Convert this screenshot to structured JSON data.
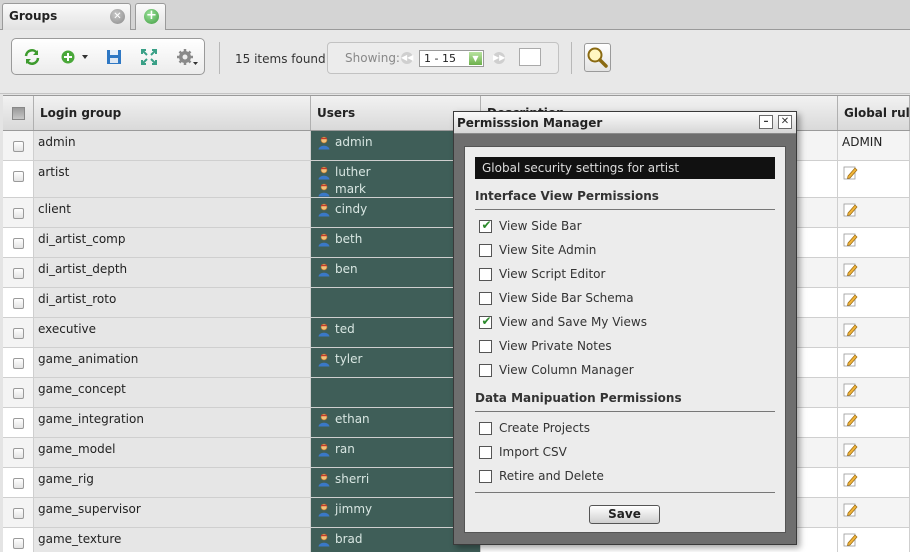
{
  "tabs": [
    {
      "label": "Groups",
      "close_glyph": "✕",
      "active": true
    }
  ],
  "add_tab_glyph": "+",
  "toolbar": {
    "icons": [
      "refresh-icon",
      "add-icon",
      "save-icon",
      "expand-icon",
      "settings-icon"
    ],
    "items_found": "15 items found",
    "showing_label": "Showing:",
    "page_range": "1 - 15",
    "prev_glyph": "◀◀",
    "next_glyph": "▶▶",
    "dropdown_glyph": "▼",
    "search_icon": "magnifier-icon"
  },
  "columns": {
    "login_group": "Login group",
    "users": "Users",
    "description": "Description",
    "global_rules": "Global rules"
  },
  "rows": [
    {
      "login": "admin",
      "users": [
        "admin"
      ],
      "global": "ADMIN"
    },
    {
      "login": "artist",
      "users": [
        "luther",
        "mark"
      ],
      "global": ""
    },
    {
      "login": "client",
      "users": [
        "cindy"
      ],
      "global": ""
    },
    {
      "login": "di_artist_comp",
      "users": [
        "beth"
      ],
      "global": ""
    },
    {
      "login": "di_artist_depth",
      "users": [
        "ben"
      ],
      "global": ""
    },
    {
      "login": "di_artist_roto",
      "users": [],
      "global": ""
    },
    {
      "login": "executive",
      "users": [
        "ted"
      ],
      "global": ""
    },
    {
      "login": "game_animation",
      "users": [
        "tyler"
      ],
      "global": ""
    },
    {
      "login": "game_concept",
      "users": [],
      "global": ""
    },
    {
      "login": "game_integration",
      "users": [
        "ethan"
      ],
      "global": ""
    },
    {
      "login": "game_model",
      "users": [
        "ran"
      ],
      "global": ""
    },
    {
      "login": "game_rig",
      "users": [
        "sherri"
      ],
      "global": ""
    },
    {
      "login": "game_supervisor",
      "users": [
        "jimmy"
      ],
      "global": ""
    },
    {
      "login": "game_texture",
      "users": [
        "brad"
      ],
      "global": ""
    }
  ],
  "dialog": {
    "title": "Permisssion Manager",
    "minimize_glyph": "–",
    "close_glyph": "✕",
    "heading": "Global security settings for artist",
    "interface_title": "Interface View Permissions",
    "interface_permissions": [
      {
        "label": "View Side Bar",
        "checked": true
      },
      {
        "label": "View Site Admin",
        "checked": false
      },
      {
        "label": "View Script Editor",
        "checked": false
      },
      {
        "label": "View Side Bar Schema",
        "checked": false
      },
      {
        "label": "View and Save My Views",
        "checked": true
      },
      {
        "label": "View Private Notes",
        "checked": false
      },
      {
        "label": "View Column Manager",
        "checked": false
      }
    ],
    "data_title": "Data Manipuation Permissions",
    "data_permissions": [
      {
        "label": "Create Projects",
        "checked": false
      },
      {
        "label": "Import CSV",
        "checked": false
      },
      {
        "label": "Retire and Delete",
        "checked": false
      }
    ],
    "save_label": "Save",
    "check_glyph": "✔"
  },
  "colors": {
    "users_column_bg": "#3f5e58",
    "dialog_frame": "#6e6e6e",
    "heading_box": "#111111"
  }
}
